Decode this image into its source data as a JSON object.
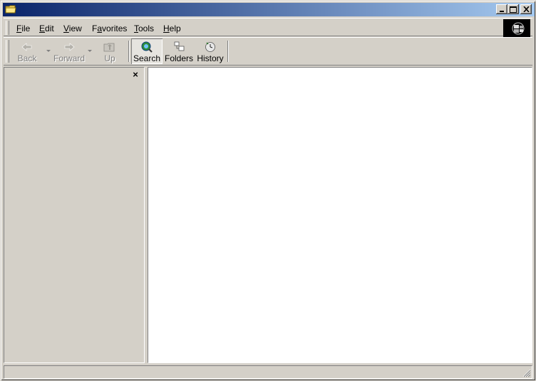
{
  "window": {
    "title": ""
  },
  "menu": {
    "items": [
      {
        "label": "File",
        "key": "F",
        "rest": "ile"
      },
      {
        "label": "Edit",
        "key": "E",
        "rest": "dit"
      },
      {
        "label": "View",
        "key": "V",
        "rest": "iew"
      },
      {
        "label": "Favorites",
        "key": "a",
        "pre": "F",
        "rest": "vorites"
      },
      {
        "label": "Tools",
        "key": "T",
        "rest": "ools"
      },
      {
        "label": "Help",
        "key": "H",
        "rest": "elp"
      }
    ]
  },
  "toolbar": {
    "back": "Back",
    "forward": "Forward",
    "up": "Up",
    "search": "Search",
    "folders": "Folders",
    "history": "History"
  },
  "left_pane": {
    "close_glyph": "×"
  },
  "colors": {
    "title_start": "#0a246a",
    "title_end": "#a6caf0",
    "face": "#d4d0c8"
  }
}
